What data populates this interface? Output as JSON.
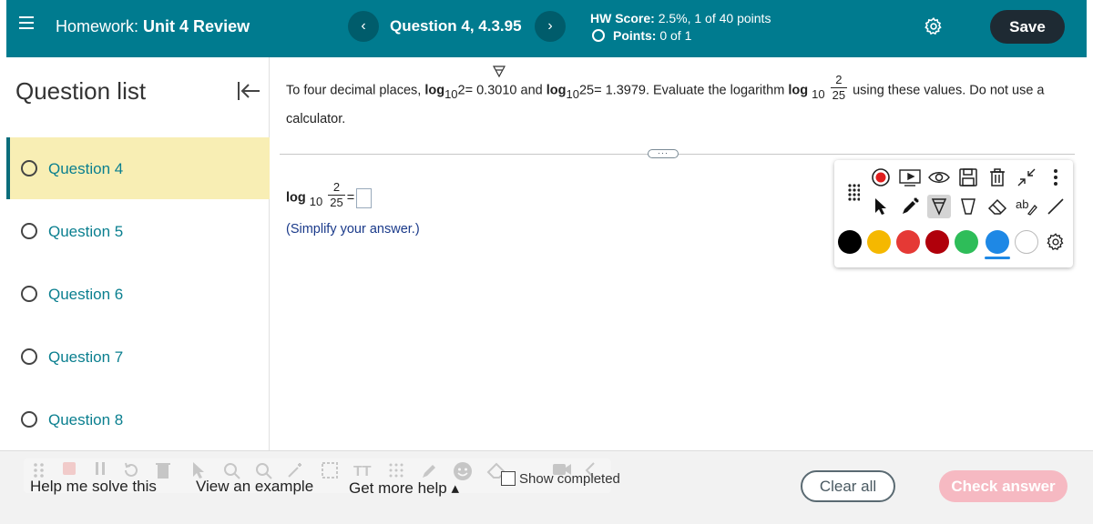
{
  "header": {
    "homework_prefix": "Homework:",
    "homework_name": "Unit 4 Review",
    "prev_label": "‹",
    "next_label": "›",
    "question_title": "Question 4, 4.3.95",
    "hw_score_label": "HW Score:",
    "hw_score_value": "2.5%, 1 of 40 points",
    "points_label": "Points:",
    "points_value": "0 of 1",
    "save_label": "Save",
    "icons": {
      "menu": "hamburger-icon",
      "settings": "gear-icon"
    }
  },
  "sidebar": {
    "title": "Question list",
    "items": [
      {
        "label": "Question 4",
        "active": true
      },
      {
        "label": "Question 5",
        "active": false
      },
      {
        "label": "Question 6",
        "active": false
      },
      {
        "label": "Question 7",
        "active": false
      },
      {
        "label": "Question 8",
        "active": false
      }
    ]
  },
  "question": {
    "intro": "To four decimal places,",
    "log_word": "log",
    "base": "10",
    "arg1": "2",
    "val1": "= 0.3010",
    "and_word": "and",
    "arg2": "25",
    "val2": "= 1.3979. Evaluate the logarithm",
    "frac_num": "2",
    "frac_den": "25",
    "tail": "using these values. Do not use a calculator.",
    "answer_equals": "=",
    "instruction": "(Simplify your answer.)"
  },
  "toolbar": {
    "colors": [
      "#000000",
      "#f5b800",
      "#e53935",
      "#b0000b",
      "#2ebd59",
      "#1e88e5",
      "#ffffff"
    ],
    "selected_color": "#1e88e5"
  },
  "bottom": {
    "help_solve": "Help me solve this",
    "view_example": "View an example",
    "more_help": "Get more help ▴",
    "show_completed": "Show completed",
    "clear_all": "Clear all",
    "check_answer": "Check answer"
  }
}
